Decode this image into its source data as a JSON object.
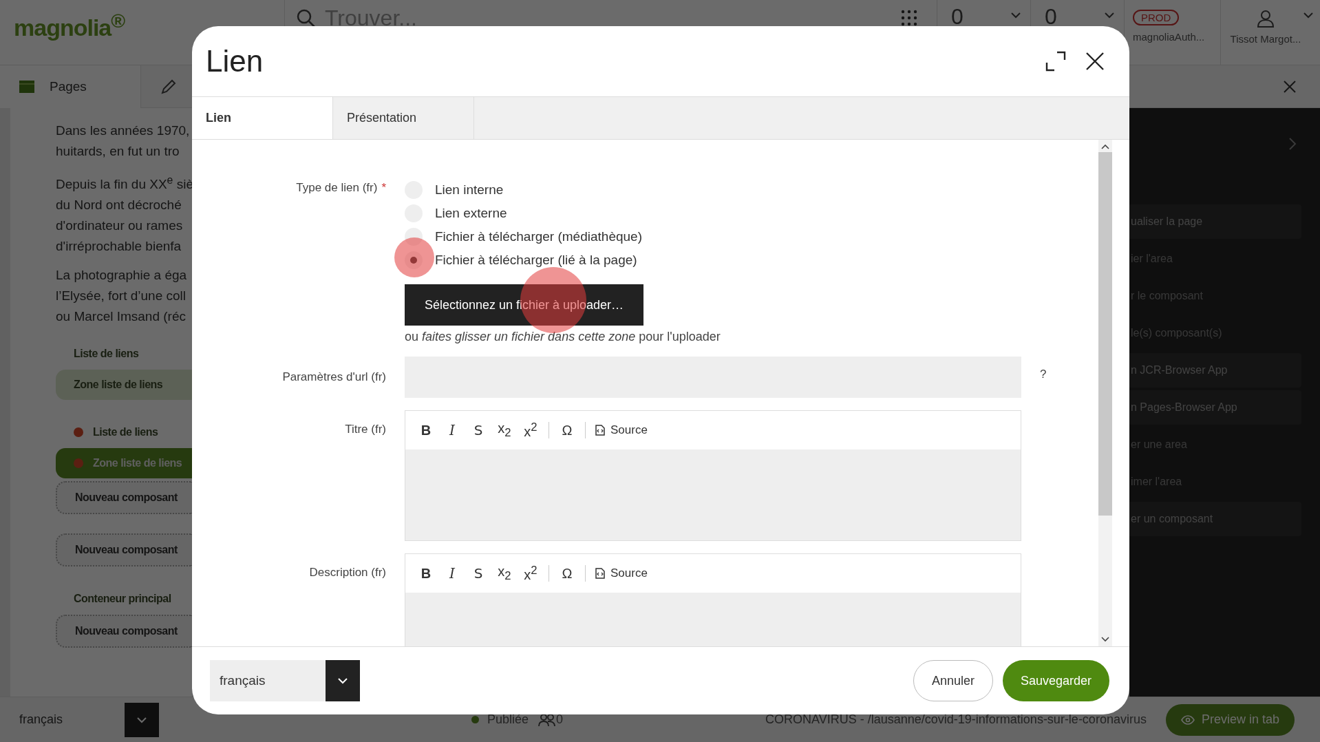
{
  "app": {
    "logo": "magnolia$^{®}$",
    "search": {
      "placeholder": "Trouver..."
    },
    "counters": [
      {
        "value": "0"
      },
      {
        "value": "0"
      }
    ],
    "environment": {
      "badge": "PROD",
      "instance": "magnoliaAuth..."
    },
    "user": {
      "name": "Tissot Margot..."
    },
    "tabs": [
      {
        "label": "Pages",
        "selected": true
      }
    ]
  },
  "page_preview": {
    "paragraphs": [
      [
        "Dans les années 1970,",
        "huitards, en fut un tro"
      ],
      [
        "Depuis la fin du XX$^{e}$ siè",
        "du Nord ont décroché",
        "d'ordinateur ou rames",
        "d'irréprochable bienfa"
      ],
      [
        "La photographie a éga",
        "l’Elysée, fort d’une coll",
        "ou Marcel Imsand (réc"
      ]
    ],
    "components": [
      {
        "kind": "heading",
        "label": "Liste de liens",
        "dot": false,
        "selected": false
      },
      {
        "kind": "zone",
        "label": "Zone liste de liens",
        "dot": false,
        "selected": false
      },
      {
        "kind": "heading",
        "label": "Liste de liens",
        "dot": true,
        "selected": false
      },
      {
        "kind": "zone",
        "label": "Zone liste de liens",
        "dot": true,
        "selected": true
      },
      {
        "kind": "new",
        "label": "Nouveau composant",
        "dot": false,
        "selected": false
      },
      {
        "kind": "new",
        "label": "Nouveau composant",
        "dot": false,
        "selected": false
      },
      {
        "kind": "heading",
        "label": "Conteneur principal",
        "dot": false,
        "selected": false
      },
      {
        "kind": "new",
        "label": "Nouveau composant",
        "dot": false,
        "selected": false
      }
    ]
  },
  "actions": {
    "items": [
      {
        "label": "ualiser la page",
        "disabled": false
      },
      {
        "label": "ier l'area",
        "disabled": true
      },
      {
        "label": "r le composant",
        "disabled": true
      },
      {
        "label": "le(s) composant(s)",
        "disabled": true
      },
      {
        "label": "n JCR-Browser App",
        "disabled": false
      },
      {
        "label": "n Pages-Browser App",
        "disabled": false
      },
      {
        "label": "er une area",
        "disabled": true
      },
      {
        "label": "imer l'area",
        "disabled": true
      },
      {
        "label": "er un composant",
        "disabled": false
      }
    ]
  },
  "status_bar": {
    "language": "français",
    "status": "Publiée",
    "viewers": "0",
    "path": "CORONAVIRUS - /lausanne/covid-19-informations-sur-le-coronavirus",
    "preview_button": "Preview in tab"
  },
  "dialog": {
    "title": "Lien",
    "tabs": [
      {
        "label": "Lien",
        "selected": true
      },
      {
        "label": "Présentation",
        "selected": false
      }
    ],
    "fields": [
      {
        "kind": "radio",
        "label": "Type de lien (fr)",
        "required_mark": "*",
        "options": [
          {
            "label": "Lien interne",
            "selected": false
          },
          {
            "label": "Lien externe",
            "selected": false
          },
          {
            "label": "Fichier à télécharger (médiathèque)",
            "selected": false
          },
          {
            "label": "Fichier à télécharger (lié à la page)",
            "selected": true
          }
        ],
        "upload_button": "Sélectionnez un fichier à uploader…",
        "drop_hint": "ou *faites glisser un fichier dans cette zone* pour l'uploader"
      },
      {
        "kind": "text",
        "label": "Paramètres d'url (fr)",
        "help": "?"
      },
      {
        "kind": "richtext",
        "label": "Titre (fr)",
        "toolbar": [
          [
            {
              "kind": "bold",
              "label": "B"
            },
            {
              "kind": "italic",
              "label": "I"
            },
            {
              "kind": "strike",
              "label": "S"
            },
            {
              "kind": "script",
              "label": "x$_{2}$"
            },
            {
              "kind": "script",
              "label": "x$^{2}$"
            }
          ],
          [
            {
              "kind": "plain",
              "label": "Ω"
            }
          ],
          [
            {
              "kind": "source",
              "label": "Source"
            }
          ]
        ]
      },
      {
        "kind": "richtext",
        "label": "Description (fr)",
        "toolbar": [
          [
            {
              "kind": "bold",
              "label": "B"
            },
            {
              "kind": "italic",
              "label": "I"
            },
            {
              "kind": "strike",
              "label": "S"
            },
            {
              "kind": "script",
              "label": "x$_{2}$"
            },
            {
              "kind": "script",
              "label": "x$^{2}$"
            }
          ],
          [
            {
              "kind": "plain",
              "label": "Ω"
            }
          ],
          [
            {
              "kind": "source",
              "label": "Source"
            }
          ]
        ]
      }
    ],
    "footer": {
      "language": "français",
      "buttons": [
        {
          "label": "Annuler",
          "kind": "secondary"
        },
        {
          "label": "Sauvegarder",
          "kind": "primary"
        }
      ]
    }
  }
}
